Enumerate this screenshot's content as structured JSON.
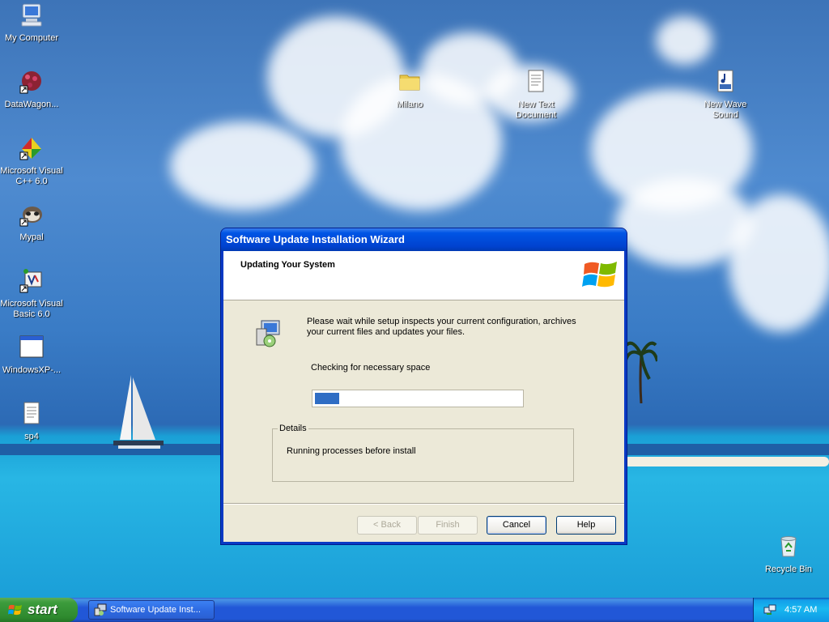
{
  "desktop": {
    "icons": [
      {
        "label": "My Computer",
        "icon": "my-computer-icon"
      },
      {
        "label": "DataWagon...",
        "icon": "datawagon-icon"
      },
      {
        "label": "Microsoft Visual C++ 6.0",
        "icon": "visual-cpp-icon"
      },
      {
        "label": "Mypal",
        "icon": "mypal-icon"
      },
      {
        "label": "Microsoft Visual Basic 6.0",
        "icon": "visual-basic-icon"
      },
      {
        "label": "WindowsXP-...",
        "icon": "window-icon"
      },
      {
        "label": "sp4",
        "icon": "text-document-icon"
      },
      {
        "label": "Milano",
        "icon": "folder-icon"
      },
      {
        "label": "New Text Document",
        "icon": "text-document-icon"
      },
      {
        "label": "New Wave Sound",
        "icon": "wav-file-icon"
      },
      {
        "label": "Recycle Bin",
        "icon": "recycle-bin-icon"
      }
    ]
  },
  "wizard": {
    "title": "Software Update Installation Wizard",
    "heading": "Updating Your System",
    "description": "Please wait while setup inspects your current configuration, archives your current files and updates your files.",
    "status": "Checking for necessary space",
    "progress_fraction": 0.12,
    "details_legend": "Details",
    "details_text": "Running processes before install",
    "buttons": {
      "back": "< Back",
      "finish": "Finish",
      "cancel": "Cancel",
      "help": "Help"
    }
  },
  "taskbar": {
    "start_label": "start",
    "task_label": "Software Update Inst...",
    "clock": "4:57 AM"
  },
  "colors": {
    "title_bar": "#0055e5",
    "start_button": "#3c9c3c",
    "taskbar": "#2157d7",
    "progress_fill": "#2f6dc4"
  }
}
